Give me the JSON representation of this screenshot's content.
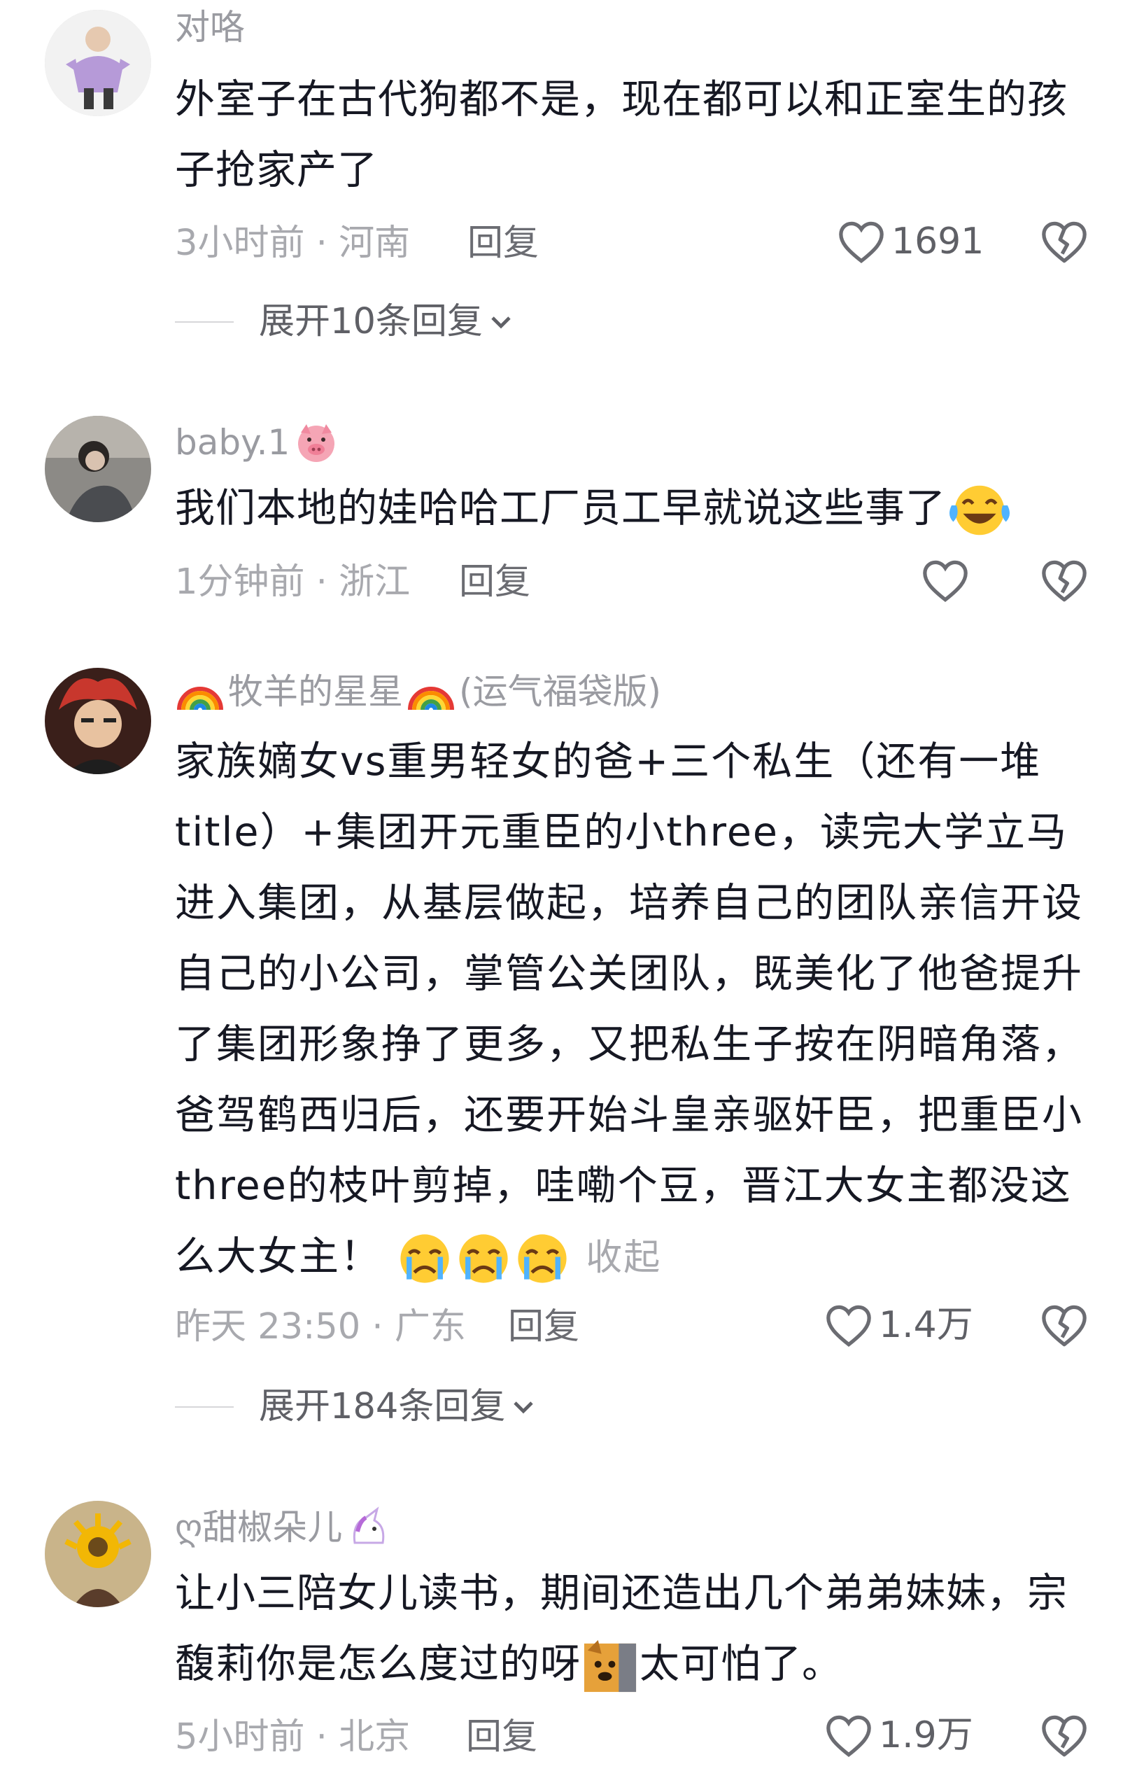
{
  "comments": [
    {
      "username": "对咯",
      "text": "外室子在古代狗都不是，现在都可以和正室生的孩子抢家产了",
      "time_location": "3小时前 · 河南",
      "reply_label": "回复",
      "likes": "1691",
      "expand_label": "展开10条回复"
    },
    {
      "username": "baby.1",
      "username_emoji": "pig-face",
      "text": "我们本地的娃哈哈工厂员工早就说这些事了",
      "text_emoji": "laughing-tears",
      "time_location": "1分钟前 · 浙江",
      "reply_label": "回复",
      "likes": ""
    },
    {
      "username_prefix_emoji": "rainbow",
      "username": "牧羊的星星",
      "username_suffix": "(运气福袋版)",
      "text": "家族嫡女vs重男轻女的爸+三个私生（还有一堆title）+集团开元重臣的小three，读完大学立马进入集团，从基层做起，培养自己的团队亲信开设自己的小公司，掌管公关团队，既美化了他爸提升了集团形象挣了更多，又把私生子按在阴暗角落，爸驾鹤西归后，还要开始斗皇亲驱奸臣，把重臣小three的枝叶剪掉，哇嘞个豆，晋江大女主都没这么大女主！",
      "text_emoji": "crying-face",
      "collapse_label": "收起",
      "time_location": "昨天 23:50 · 广东",
      "reply_label": "回复",
      "likes": "1.4万",
      "expand_label": "展开184条回复"
    },
    {
      "username": "ღ甜椒朵儿",
      "username_emoji": "unicorn",
      "text_part1": "让小三陪女儿读书，期间还造出几个弟弟妹妹，宗馥莉你是怎么度过的呀",
      "text_emoji": "dog-peeking",
      "text_part2": "太可怕了。",
      "time_location": "5小时前 · 北京",
      "reply_label": "回复",
      "likes": "1.9万"
    }
  ],
  "colors": {
    "text": "#161823",
    "secondary": "#a8a9ae",
    "username": "#9a9ba1",
    "reply": "#6b6c72"
  }
}
